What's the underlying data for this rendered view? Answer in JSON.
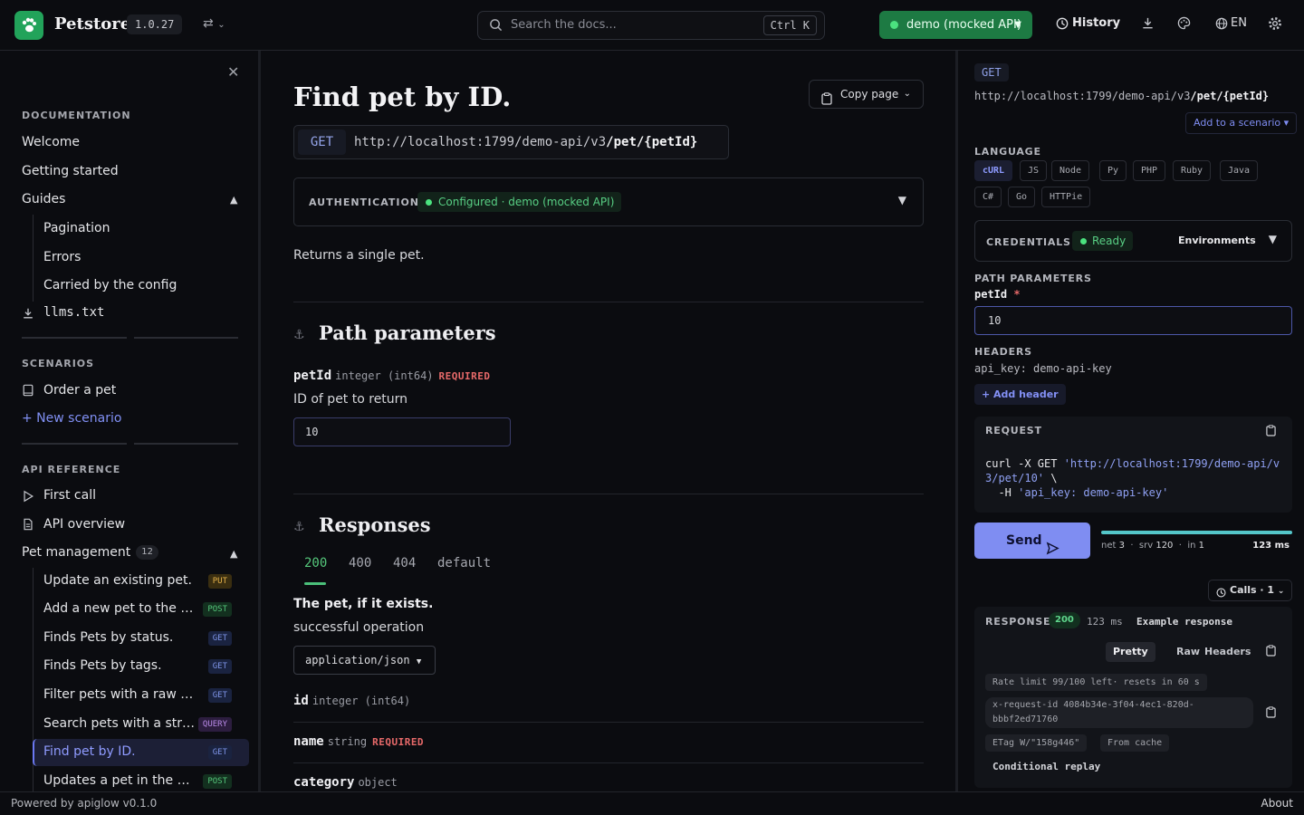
{
  "colors": {
    "accent": "#7f8df2",
    "success": "#4be27f",
    "brand": "#22a35a",
    "danger": "#e86a6a"
  },
  "topbar": {
    "brand": "Petstore",
    "version": "1.0.27",
    "search_placeholder": "Search the docs...",
    "search_shortcut": "Ctrl K",
    "environment": "demo (mocked API)",
    "history_label": "History",
    "language": "EN",
    "icons": [
      "paw-icon",
      "swap-icon",
      "search-icon",
      "clock-icon",
      "download-icon",
      "palette-icon",
      "globe-icon",
      "gear-icon"
    ]
  },
  "sidebar": {
    "documentation": {
      "title": "DOCUMENTATION",
      "items": [
        "Welcome",
        "Getting started"
      ],
      "guides_label": "Guides",
      "guides": [
        "Pagination",
        "Errors",
        "Carried by the config"
      ],
      "llms": "llms.txt"
    },
    "scenarios": {
      "title": "SCENARIOS",
      "items": [
        "Order a pet"
      ],
      "new_label": "+ New scenario"
    },
    "api_reference": {
      "title": "API REFERENCE",
      "items": [
        "First call",
        "API overview"
      ],
      "group_label": "Pet management",
      "group_count": "12",
      "endpoints": [
        {
          "label": "Update an existing pet.",
          "method": "PUT"
        },
        {
          "label": "Add a new pet to the store.",
          "method": "POST"
        },
        {
          "label": "Finds Pets by status.",
          "method": "GET"
        },
        {
          "label": "Finds Pets by tags.",
          "method": "GET"
        },
        {
          "label": "Filter pets with a raw query.",
          "method": "GET"
        },
        {
          "label": "Search pets with a structured query.",
          "method": "QUERY"
        },
        {
          "label": "Find pet by ID.",
          "method": "GET",
          "active": true
        },
        {
          "label": "Updates a pet in the store.",
          "method": "POST"
        }
      ]
    }
  },
  "main": {
    "title": "Find pet by ID.",
    "copy_page": "Copy page",
    "method": "GET",
    "url_base": "http://localhost:1799/demo-api/v3",
    "url_path": "/pet/{petId}",
    "auth_label": "AUTHENTICATION",
    "auth_status": "Configured · demo (mocked API)",
    "description": "Returns a single pet.",
    "path_params_title": "Path parameters",
    "param": {
      "name": "petId",
      "type": "integer (int64)",
      "required": "REQUIRED",
      "description": "ID of pet to return",
      "value": "10"
    },
    "responses_title": "Responses",
    "response_tabs": [
      "200",
      "400",
      "404",
      "default"
    ],
    "response_title": "The pet, if it exists.",
    "response_desc": "successful operation",
    "content_type": "application/json",
    "fields": [
      {
        "name": "id",
        "type": "integer (int64)",
        "required": ""
      },
      {
        "name": "name",
        "type": "string",
        "required": "REQUIRED"
      },
      {
        "name": "category",
        "type": "object",
        "required": ""
      }
    ]
  },
  "right": {
    "method": "GET",
    "url_base": "http://localhost:1799/demo-api/v3",
    "url_path": "/pet/{petId}",
    "add_scenario": "Add to a scenario ▾",
    "language_title": "LANGUAGE",
    "languages": [
      "cURL",
      "JS",
      "Node",
      "Py",
      "PHP",
      "Ruby",
      "Java",
      "C#",
      "Go",
      "HTTPie"
    ],
    "credentials_title": "CREDENTIALS",
    "credentials_status": "Ready",
    "environments": "Environments",
    "path_params_title": "PATH PARAMETERS",
    "param_name": "petId",
    "param_required_mark": "*",
    "param_value": "10",
    "headers_title": "HEADERS",
    "header_line": "api_key: demo-api-key",
    "add_header": "+ Add header",
    "request_title": "REQUEST",
    "curl_prefix": "curl -X GET ",
    "curl_url": "'http://localhost:1799/demo-api/v3/pet/10'",
    "curl_cont": " \\\n  -H ",
    "curl_header": "'api_key: demo-api-key'",
    "send_label": "Send",
    "timing": {
      "net_label": "net",
      "net": "3",
      "srv_label": "srv",
      "srv": "120",
      "in_label": "in",
      "in": "1",
      "total": "123 ms",
      "fill_fraction": 1.0
    },
    "calls_label": "Calls · 1",
    "response_title": "RESPONSE",
    "status_code": "200",
    "response_ms": "123 ms",
    "example_label": "Example response",
    "response_tabs": [
      "Pretty",
      "Raw",
      "Headers"
    ],
    "chips": {
      "rate_limit": "Rate limit 99/100 left· resets in 60 s",
      "request_id": "x-request-id 4084b34e-3f04-4ec1-820d-bbbf2ed71760",
      "etag": "ETag W/\"158g446\"",
      "cache": "From cache"
    },
    "conditional": "Conditional replay"
  },
  "footer": {
    "powered": "Powered by apiglow v0.1.0",
    "about": "About"
  }
}
